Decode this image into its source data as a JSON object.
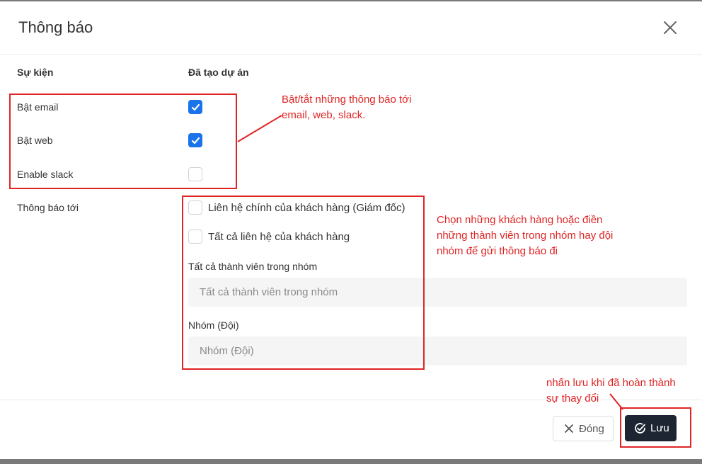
{
  "dialog": {
    "title": "Thông báo",
    "close_icon": "close-icon"
  },
  "table": {
    "col_event": "Sự kiện",
    "col_project": "Đã tạo dự án",
    "rows": [
      {
        "label": "Bật email",
        "checked": true
      },
      {
        "label": "Bật web",
        "checked": true
      },
      {
        "label": "Enable slack",
        "checked": false
      }
    ]
  },
  "notify_to": {
    "label": "Thông báo tới",
    "options": [
      {
        "label": "Liên hệ chính của khách hàng (Giám đốc)",
        "checked": false
      },
      {
        "label": "Tất cả liên hệ của khách hàng",
        "checked": false
      }
    ],
    "members": {
      "label": "Tất cả thành viên trong nhóm",
      "placeholder": "Tất cả thành viên trong nhóm"
    },
    "team": {
      "label": "Nhóm (Đội)",
      "placeholder": "Nhóm (Đội)"
    }
  },
  "footer": {
    "close_label": "Đóng",
    "save_label": "Lưu"
  },
  "annotations": {
    "note1_line1": "Bật/tắt những thông báo tới",
    "note1_line2": "email, web, slack.",
    "note2_line1": "Chọn những khách hàng hoặc điền",
    "note2_line2": "những thành viên trong nhóm hay đội",
    "note2_line3": "nhóm để gửi thông báo đi",
    "note3_line1": "nhấn lưu khi đã hoàn thành",
    "note3_line2": "sự thay đổi"
  },
  "colors": {
    "accent": "#1a73e8",
    "annotation": "#e02424",
    "save_button": "#1d2532"
  }
}
